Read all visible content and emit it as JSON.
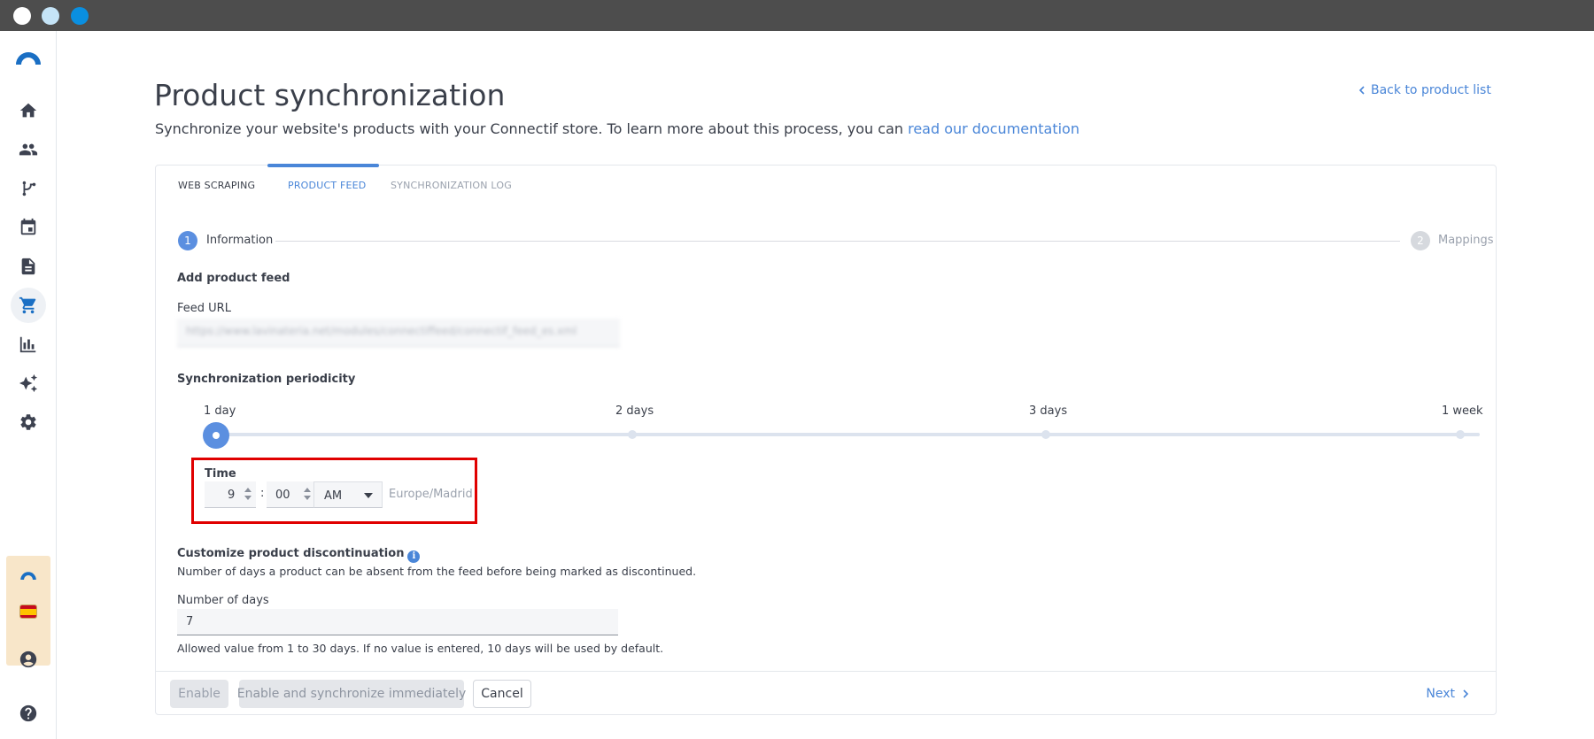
{
  "colors": {
    "accent": "#4a86d8",
    "highlight": "#e00000",
    "sidebar_account_bg": "#f8e6c9"
  },
  "sidebar": {
    "items": [
      {
        "icon": "home-icon"
      },
      {
        "icon": "contacts-icon"
      },
      {
        "icon": "workflow-icon"
      },
      {
        "icon": "calendar-icon"
      },
      {
        "icon": "document-icon"
      },
      {
        "icon": "cart-icon",
        "active": true
      },
      {
        "icon": "bar-chart-icon"
      },
      {
        "icon": "sparkle-icon"
      },
      {
        "icon": "gear-icon"
      }
    ],
    "bottom_items": [
      {
        "icon": "account-circle-icon"
      },
      {
        "icon": "help-icon"
      }
    ]
  },
  "header": {
    "title": "Product synchronization",
    "subtitle_text": "Synchronize your website's products with your Connectif store. To learn more about this process, you can ",
    "subtitle_link": "read our documentation",
    "back_link": "Back to product list"
  },
  "tabs": [
    {
      "label": "WEB SCRAPING",
      "active": false
    },
    {
      "label": "PRODUCT FEED",
      "active": true
    },
    {
      "label": "SYNCHRONIZATION LOG",
      "active": false
    }
  ],
  "stepper": {
    "steps": [
      {
        "number": "1",
        "label": "Information",
        "active": true
      },
      {
        "number": "2",
        "label": "Mappings",
        "active": false
      }
    ]
  },
  "form": {
    "add_feed_title": "Add product feed",
    "feed_url_label": "Feed URL",
    "feed_url_value": "https://www.lavinateria.net/modules/connectiffeed/connectif_feed_es.xml",
    "periodicity_title": "Synchronization periodicity",
    "periodicity_options": [
      "1 day",
      "2 days",
      "3 days",
      "1 week"
    ],
    "periodicity_selected": "1 day",
    "time_label": "Time",
    "hour": "9",
    "minute": "00",
    "colon": ":",
    "meridiem": "AM",
    "timezone": "Europe/Madrid",
    "discontinuation_title": "Customize product discontinuation",
    "discontinuation_desc": "Number of days a product can be absent from the feed before being marked as discontinued.",
    "days_label": "Number of days",
    "days_value": "7",
    "days_help": "Allowed value from 1 to 30 days. If no value is entered, 10 days will be used by default."
  },
  "footer": {
    "enable": "Enable",
    "enable_sync": "Enable and synchronize immediately",
    "cancel": "Cancel",
    "next": "Next"
  }
}
